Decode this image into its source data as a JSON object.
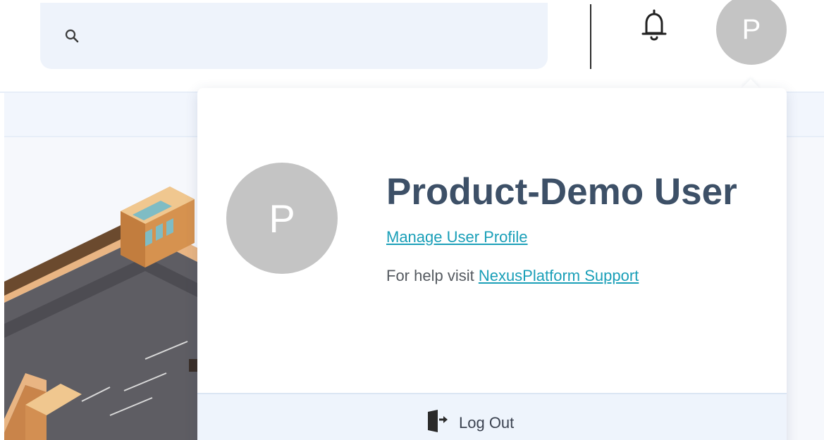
{
  "header": {
    "search": {
      "icon": "search-icon",
      "placeholder": "",
      "value": ""
    },
    "notifications_icon": "bell-icon",
    "avatar_initial": "P"
  },
  "profile_menu": {
    "avatar_initial": "P",
    "user_name": "Product-Demo User",
    "manage_profile_label": "Manage User Profile",
    "help_prefix": "For help visit ",
    "support_link_label": "NexusPlatform Support",
    "logout": {
      "icon": "door-exit-icon",
      "label": "Log Out"
    }
  },
  "colors": {
    "avatar_bg": "#c4c4c4",
    "user_name": "#3d5067",
    "link": "#1a9fb8",
    "search_bg": "#eef3fb",
    "logout_bar_bg": "#eef4fc"
  }
}
